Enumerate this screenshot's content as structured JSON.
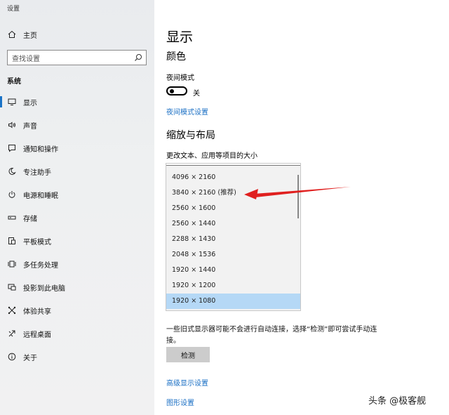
{
  "app_title": "设置",
  "sidebar": {
    "home_label": "主页",
    "search_placeholder": "查找设置",
    "section_header": "系统",
    "items": [
      {
        "label": "显示",
        "icon": "monitor-icon"
      },
      {
        "label": "声音",
        "icon": "speaker-icon"
      },
      {
        "label": "通知和操作",
        "icon": "notification-icon"
      },
      {
        "label": "专注助手",
        "icon": "moon-icon"
      },
      {
        "label": "电源和睡眠",
        "icon": "power-icon"
      },
      {
        "label": "存储",
        "icon": "storage-icon"
      },
      {
        "label": "平板模式",
        "icon": "tablet-icon"
      },
      {
        "label": "多任务处理",
        "icon": "multitask-icon"
      },
      {
        "label": "投影到此电脑",
        "icon": "project-icon"
      },
      {
        "label": "体验共享",
        "icon": "share-icon"
      },
      {
        "label": "远程桌面",
        "icon": "remote-desktop-icon"
      },
      {
        "label": "关于",
        "icon": "info-icon"
      }
    ]
  },
  "main": {
    "title": "显示",
    "color_heading": "颜色",
    "night_mode_label": "夜间模式",
    "night_mode_state": "关",
    "night_mode_link": "夜间模式设置",
    "scale_heading": "缩放与布局",
    "scale_label": "更改文本、应用等项目的大小",
    "resolutions": [
      "4096 × 2160",
      "3840 × 2160 (推荐)",
      "2560 × 1600",
      "2560 × 1440",
      "2288 × 1430",
      "2048 × 1536",
      "1920 × 1440",
      "1920 × 1200",
      "1920 × 1080"
    ],
    "selected_resolution": "1920 × 1080",
    "detect_note": "一些旧式显示器可能不会进行自动连接，选择“检测”即可尝试手动连接。",
    "detect_button": "检测",
    "advanced_link": "高级显示设置",
    "graphics_link": "图形设置"
  },
  "watermark": "头条 @极客舰",
  "colors": {
    "accent": "#1a73c7",
    "link": "#1a6fc4",
    "selection": "#b5d8f6",
    "annotation_arrow": "#e0201f"
  }
}
